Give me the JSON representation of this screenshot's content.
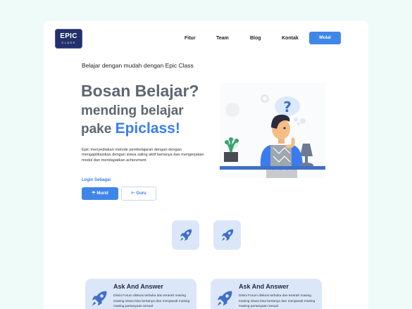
{
  "brand": {
    "logo_line1": "EPIC",
    "logo_line2": "CLASS"
  },
  "nav": {
    "items": [
      "Fitur",
      "Team",
      "Blog",
      "Kontak"
    ],
    "cta": "Mulai"
  },
  "hero": {
    "tagline": "Belajar dengan mudah dengan Epic Class",
    "title_line1": "Bosan Belajar?",
    "title_line2": "mending belajar",
    "title_line3_prefix": "pake ",
    "title_line3_accent": "Epiclass!",
    "description": "Epic menyediakan metode pembelajaran dengan dengan mengaplikasikan dengan siswa saling aktif bertanya dan mengerjakan modul dan mendapatkan achievment",
    "login_label": "Login Sebagai",
    "btn_murid": "Murid",
    "btn_guru": "Guru"
  },
  "features": [
    {
      "title": "Ask And Answer",
      "desc": "Disini Forum diskusi terbuka dan terarah masing masing siswa bisa bertanya dan menjawab masing masing pertanyaan sesual"
    },
    {
      "title": "Ask And Answer",
      "desc": "Disini Forum diskusi terbuka dan terarah masing masing siswa bisa bertanya dan menjawab masing masing pertanyaan sesual"
    }
  ],
  "colors": {
    "accent": "#3f86e8",
    "heading": "#5e6670",
    "tile": "#dbe7f9",
    "logo": "#23306a"
  }
}
